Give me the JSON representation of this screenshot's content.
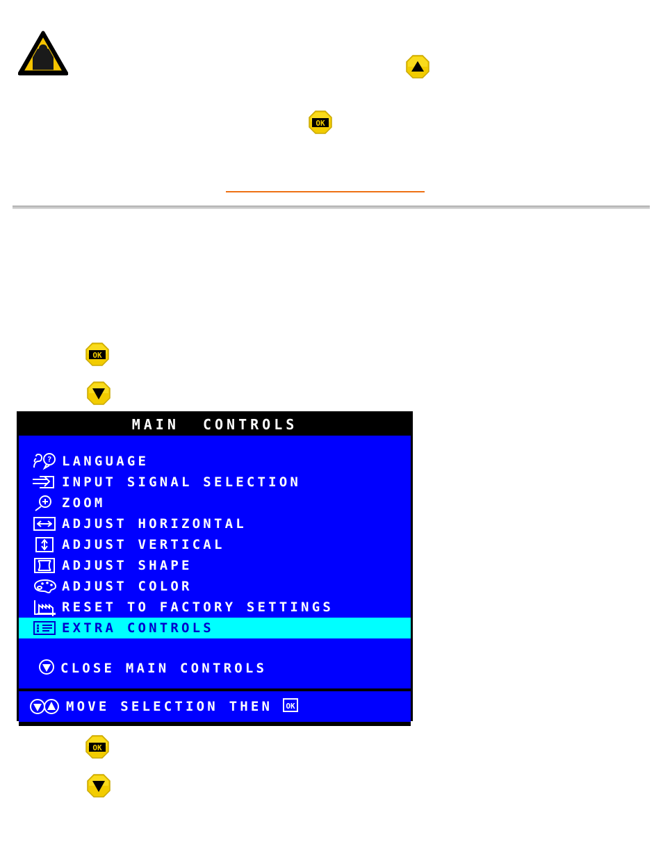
{
  "page": {
    "warning_icon": "warning-triangle-icon",
    "divider_color": "#c8c8c8",
    "link_underline_color": "#ee7013"
  },
  "controls": {
    "up_button": "up-arrow-button",
    "down_button": "down-arrow-button",
    "ok_button": "ok-button"
  },
  "osd": {
    "title": "MAIN  CONTROLS",
    "background_color": "#0000ff",
    "highlight_color": "#00ffff",
    "text_color": "#ffffff",
    "highlight_text_color": "#0000cc",
    "items": [
      {
        "icon": "language-icon",
        "label": "LANGUAGE",
        "selected": false
      },
      {
        "icon": "input-signal-icon",
        "label": "INPUT SIGNAL SELECTION",
        "selected": false
      },
      {
        "icon": "zoom-icon",
        "label": "ZOOM",
        "selected": false
      },
      {
        "icon": "adjust-horizontal-icon",
        "label": "ADJUST HORIZONTAL",
        "selected": false
      },
      {
        "icon": "adjust-vertical-icon",
        "label": "ADJUST VERTICAL",
        "selected": false
      },
      {
        "icon": "adjust-shape-icon",
        "label": "ADJUST SHAPE",
        "selected": false
      },
      {
        "icon": "adjust-color-icon",
        "label": "ADJUST COLOR",
        "selected": false
      },
      {
        "icon": "factory-reset-icon",
        "label": "RESET TO FACTORY SETTINGS",
        "selected": false
      },
      {
        "icon": "extra-controls-icon",
        "label": "EXTRA CONTROLS",
        "selected": true
      }
    ],
    "close_label": "CLOSE MAIN CONTROLS",
    "close_icon": "down-arrow-circle-icon",
    "footer_label": "MOVE SELECTION THEN",
    "footer_icons": "down-up-arrow-circle-icons",
    "footer_ok": "OK"
  }
}
